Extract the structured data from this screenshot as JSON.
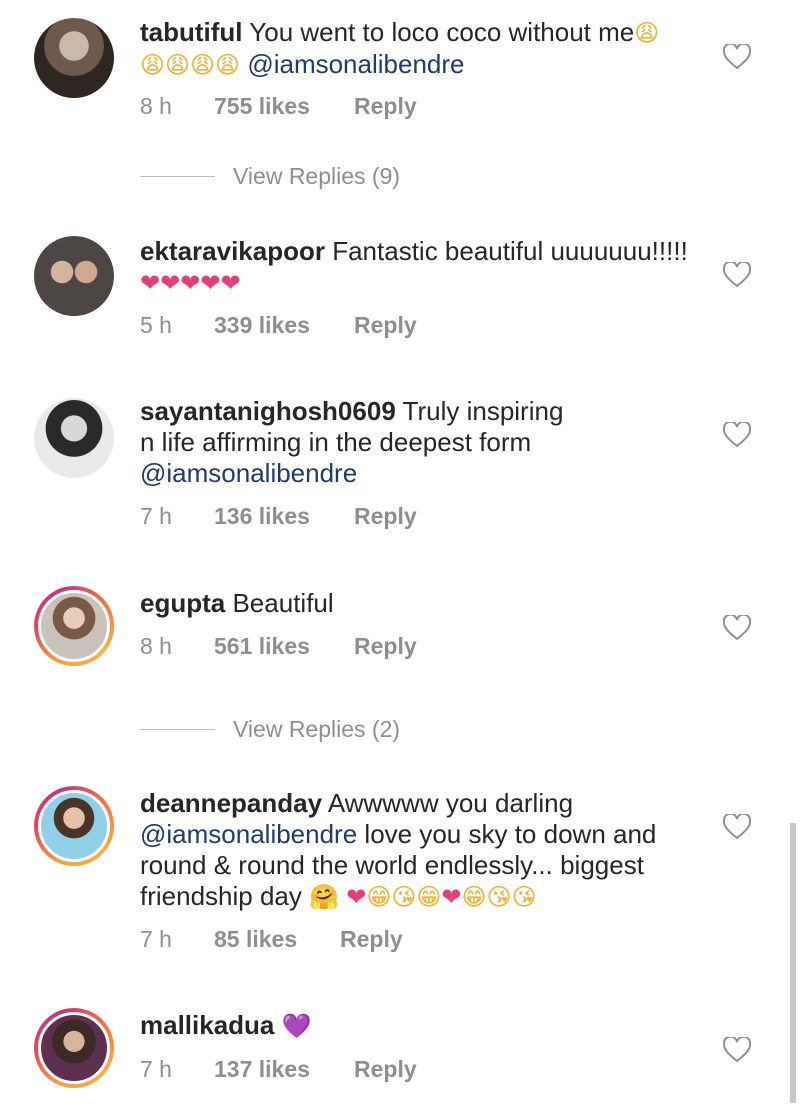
{
  "comments": [
    {
      "username": "tabutiful",
      "text": "You went to loco coco without me",
      "emojis_inline": "😩",
      "emojis_line2": "😩😩😩😩",
      "mention": "@iamsonalibendre",
      "time": "8 h",
      "likes": "755 likes",
      "reply": "Reply",
      "view_replies": "View Replies (9)"
    },
    {
      "username": "ektaravikapoor",
      "text": "Fantastic beautiful uuuuuuu!!!!!",
      "emojis_line2": "❤❤❤❤❤",
      "time": "5 h",
      "likes": "339 likes",
      "reply": "Reply"
    },
    {
      "username": "sayantanighosh0609",
      "line1": "Truly inspiring",
      "line2": "n life affirming in the deepest form",
      "mention": "@iamsonalibendre",
      "time": "7 h",
      "likes": "136 likes",
      "reply": "Reply"
    },
    {
      "username": "egupta",
      "text": "Beautiful",
      "time": "8 h",
      "likes": "561 likes",
      "reply": "Reply",
      "view_replies": "View Replies (2)"
    },
    {
      "username": "deannepanday",
      "line1": "Awwwww you darling",
      "mention": "@iamsonalibendre",
      "line2": "love you sky to down and",
      "line3": "round & round the world endlessly... biggest",
      "line4": "friendship day",
      "emojis_a": "🤗",
      "emojis_b": "❤",
      "emojis_c": "😁😘😁",
      "emojis_d": "❤",
      "emojis_e": "😁😘😘",
      "time": "7 h",
      "likes": "85 likes",
      "reply": "Reply"
    },
    {
      "username": "mallikadua",
      "emoji": "💜",
      "time": "7 h",
      "likes": "137 likes",
      "reply": "Reply"
    }
  ],
  "icons": {
    "like": "heart-outline-icon"
  },
  "colors": {
    "mention": "#1f3b6b",
    "meta": "#8e8e8e",
    "heart_emoji": "#e33f7a",
    "purple_heart": "#7b3fd6"
  }
}
